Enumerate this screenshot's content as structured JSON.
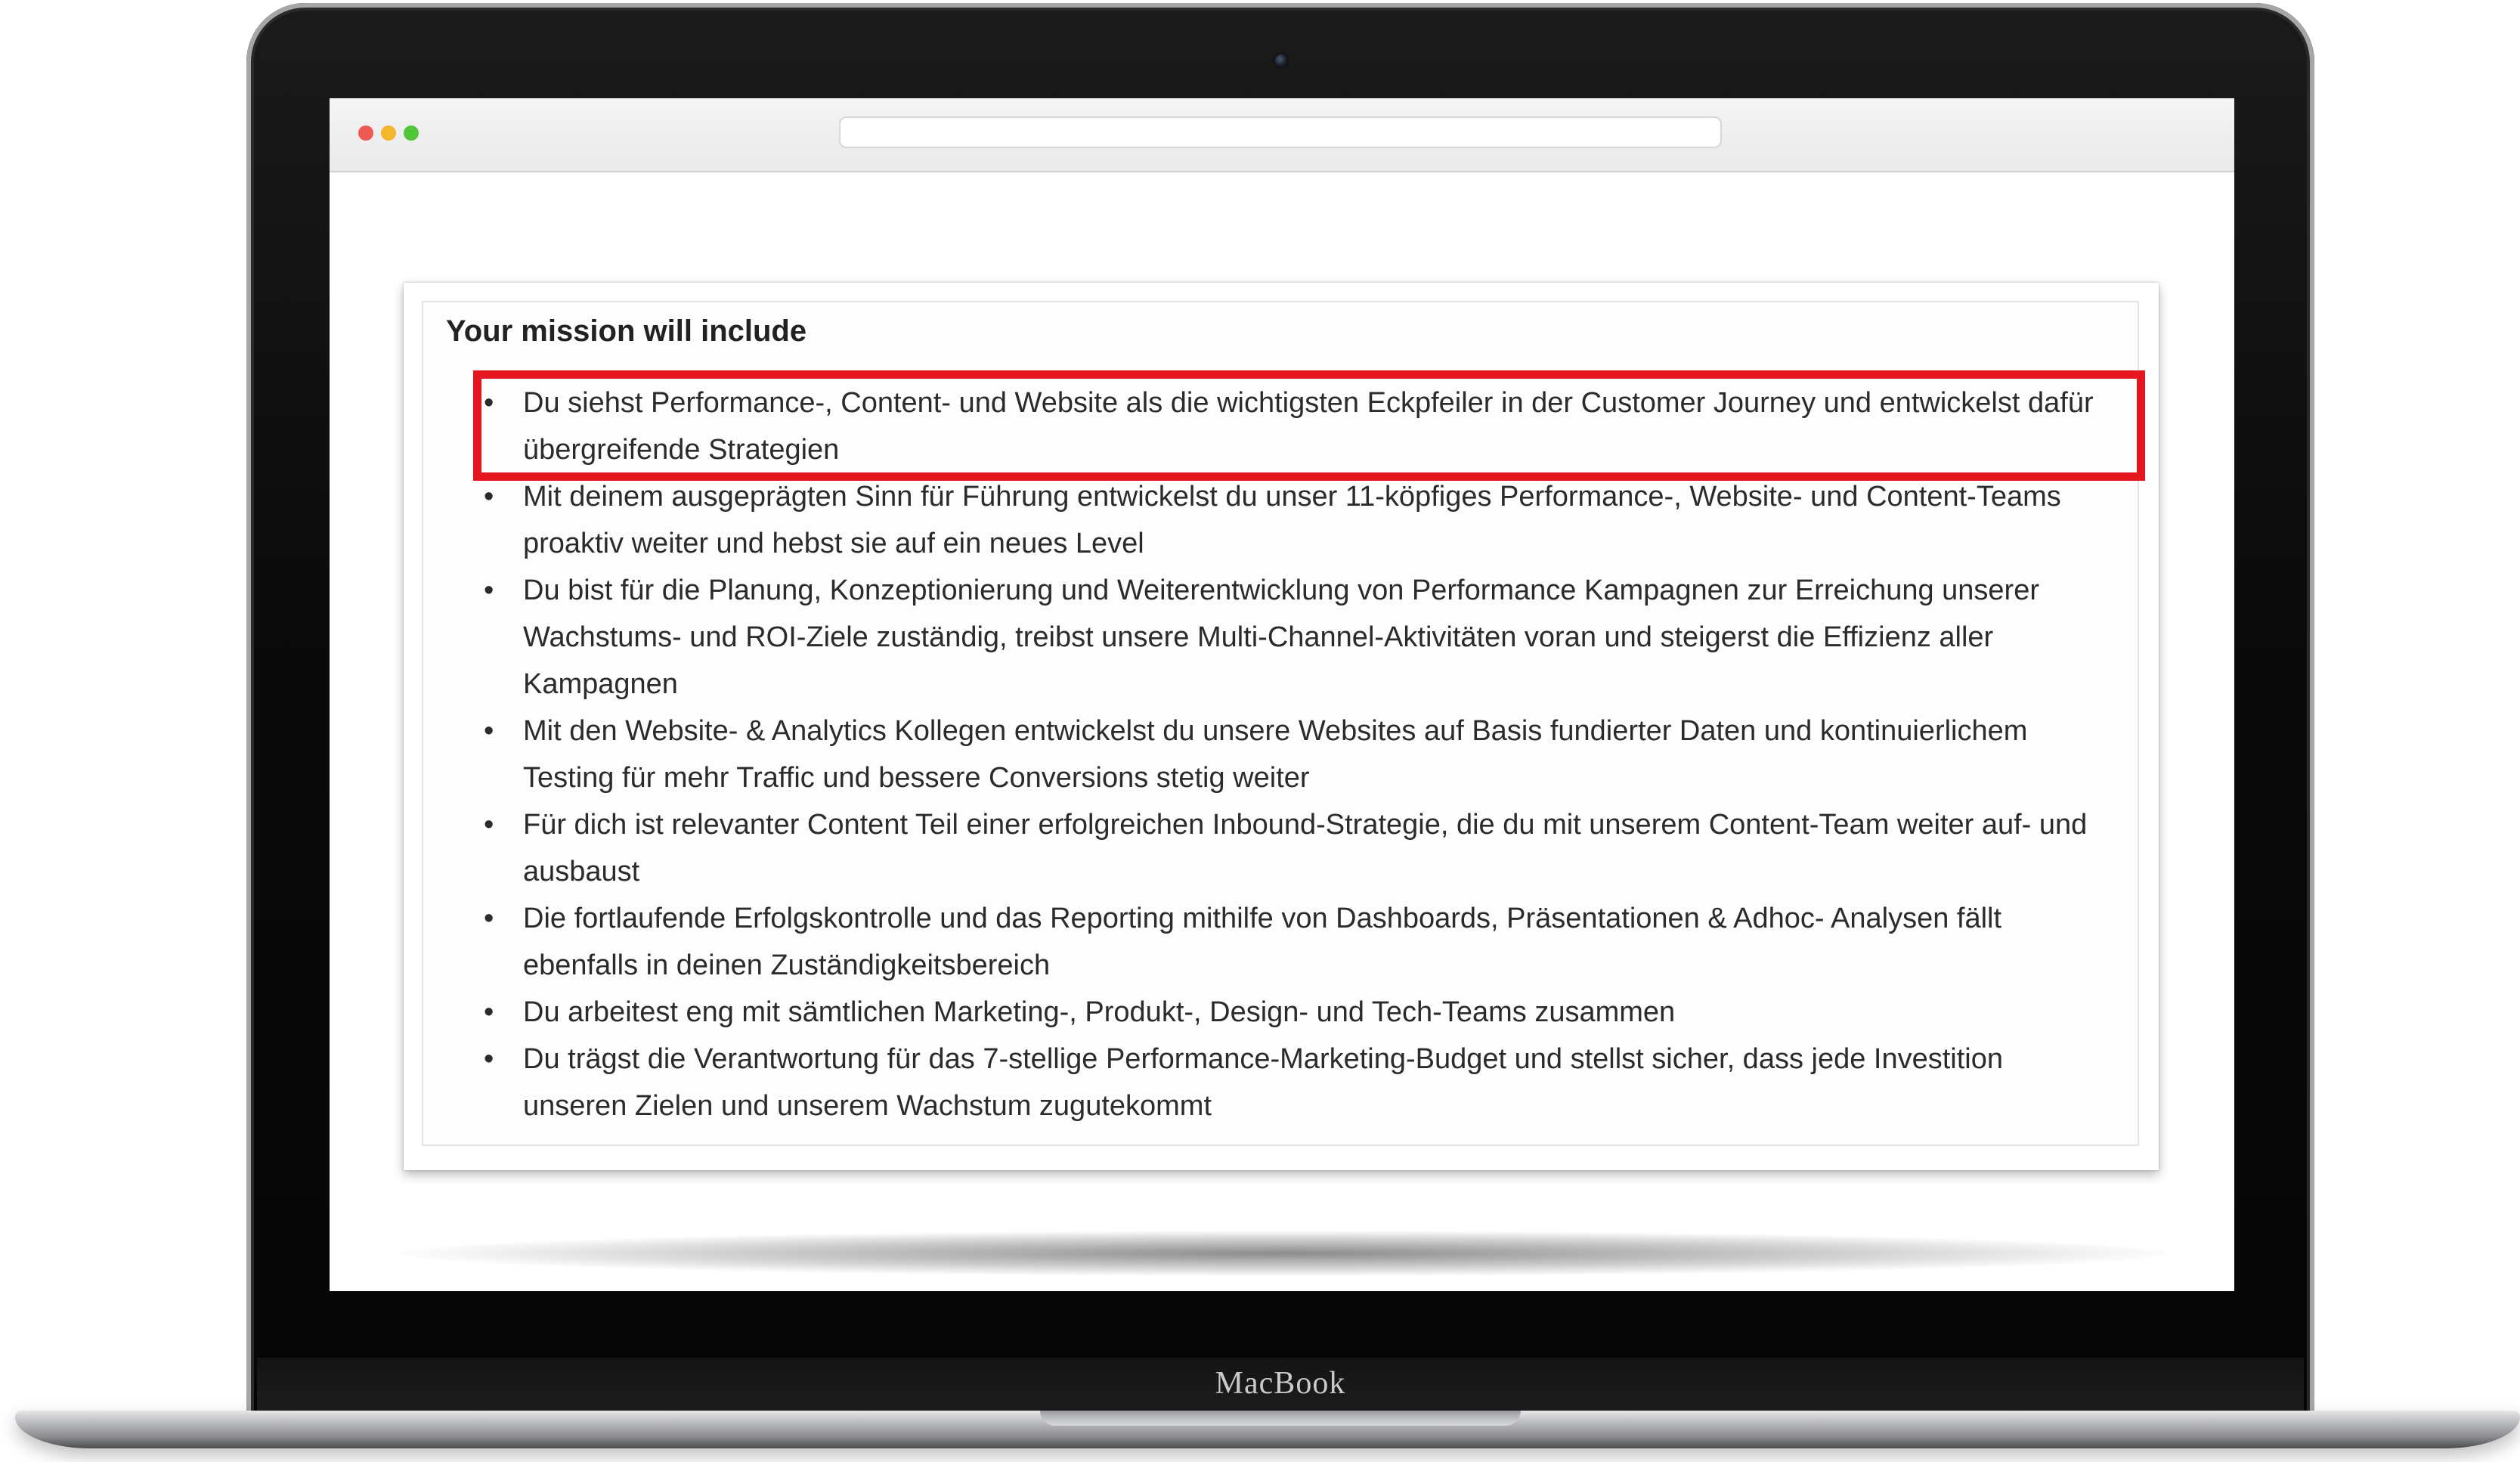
{
  "device": {
    "brand_label": "MacBook"
  },
  "browser": {
    "address_bar_value": ""
  },
  "section": {
    "title": "Your mission will include",
    "items": [
      "Du siehst Performance-, Content- und Website als die wichtigsten Eckpfeiler in der Customer Journey und entwickelst dafür übergreifende Strategien",
      "Mit deinem ausgeprägten Sinn für Führung entwickelst du unser 11-köpfiges Performance-, Website- und Content-Teams proaktiv weiter und hebst sie auf ein neues Level",
      "Du bist für die Planung, Konzeptionierung und Weiterentwicklung von Performance Kampagnen zur Erreichung unserer Wachstums- und ROI-Ziele zuständig, treibst unsere Multi-Channel-Aktivitäten voran und steigerst die Effizienz aller Kampagnen",
      "Mit den Website- & Analytics Kollegen entwickelst du unsere Websites auf Basis fundierter Daten und kontinuierlichem Testing für mehr Traffic und bessere Conversions stetig weiter",
      "Für dich ist relevanter Content Teil einer erfolgreichen Inbound-Strategie, die du mit unserem Content-Team weiter auf- und ausbaust",
      "Die fortlaufende Erfolgskontrolle und das Reporting mithilfe von Dashboards, Präsentationen & Adhoc- Analysen fällt ebenfalls in deinen Zuständigkeitsbereich",
      "Du arbeitest eng mit sämtlichen Marketing-, Produkt-, Design- und Tech-Teams zusammen",
      "Du trägst die Verantwortung für das 7-stellige Performance-Marketing-Budget und stellst sicher, dass jede Investition unseren Zielen und unserem Wachstum zugutekommt"
    ],
    "bullet_glyph": "•",
    "highlighted_item_index": 0
  },
  "colors": {
    "highlight_border": "#e5161f",
    "traffic_red": "#ee5a52",
    "traffic_yellow": "#f3b62c",
    "traffic_green": "#4fc53a"
  }
}
